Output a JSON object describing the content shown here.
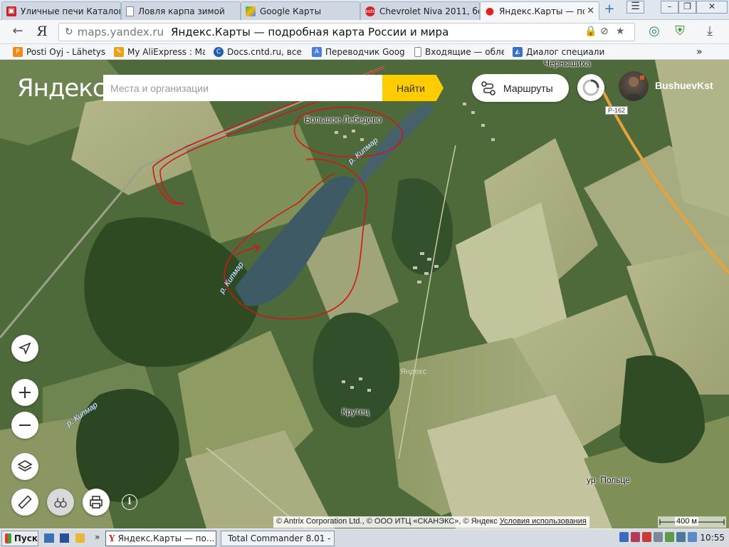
{
  "browser": {
    "tabs": [
      {
        "label": "Уличные печи Каталог",
        "active": false
      },
      {
        "label": "Ловля карпа зимой",
        "active": false
      },
      {
        "label": "Google Карты",
        "active": false
      },
      {
        "label": "Chevrolet Niva 2011, бе",
        "active": false
      },
      {
        "label": "Яндекс.Карты — подр",
        "active": true
      }
    ],
    "new_tab": "+",
    "url_host": "maps.yandex.ru",
    "page_title": "Яндекс.Карты — подробная карта России и мира",
    "bookmarks": [
      "Posti Oyj - Lähetys",
      "My AliExpress : Ma",
      "Docs.cntd.ru, все",
      "Переводчик Googl",
      "Входящие — обле",
      "Диалог специалис"
    ],
    "more_bookmarks": "»"
  },
  "yandex": {
    "logo": "Яндекс",
    "search_placeholder": "Места и организации",
    "find_label": "Найти",
    "routes_label": "Маршруты",
    "user_name": "BushuevKst"
  },
  "map": {
    "places": {
      "bolshoe_lebedevo": "Большое Лебедево",
      "krutec": "Крутец",
      "ur_polce": "ур. Польце",
      "chernyshikha": "Чернышиха",
      "watermark": "Яндекс"
    },
    "rivers": {
      "r1": "р. Кипмар",
      "r2": "р. Кипмар",
      "r3": "р. Кипмар"
    },
    "road_shield": "Р-162",
    "copyright": "© Antrix Corporation Ltd., © ООО ИТЦ «СКАНЭКС», © Яндекс",
    "terms": "Условия использования",
    "scale": "400 м"
  },
  "taskbar": {
    "start": "Пуск",
    "tasks": [
      "Яндекс.Карты — по...",
      "Total Commander 8.01 - ..."
    ],
    "quick_more": "»",
    "clock": "10:55"
  },
  "colors": {
    "yandex_yellow": "#ffcc00",
    "annotation_red": "#d01818",
    "road_orange": "#e8a23a"
  }
}
